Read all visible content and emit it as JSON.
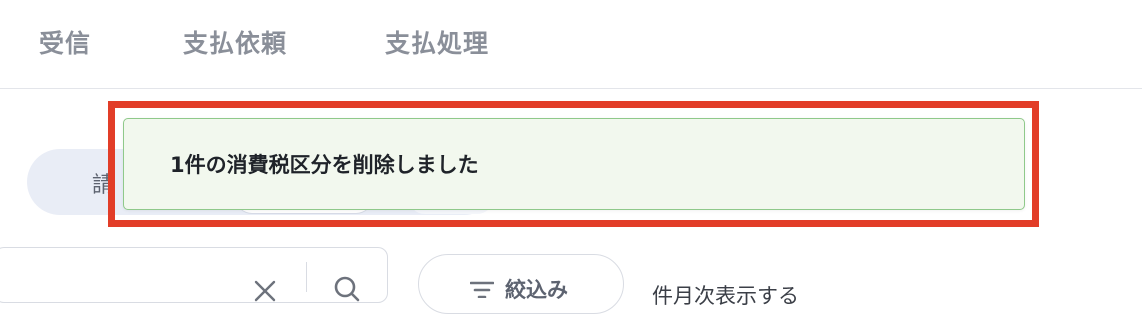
{
  "nav": {
    "tabs": [
      {
        "label": "受信"
      },
      {
        "label": "支払依頼"
      },
      {
        "label": "支払処理"
      }
    ]
  },
  "segment": {
    "visible_label": "請"
  },
  "filter": {
    "label": "絞込み"
  },
  "tail_text": "件月次表示する",
  "toast": {
    "message": "1件の消費税区分を削除しました"
  },
  "icons": {
    "clear": "close-icon",
    "search": "search-icon",
    "filter": "filter-icon"
  },
  "colors": {
    "highlight": "#e23d28",
    "toast_background": "#f2f8ee",
    "toast_border": "#8fc98a",
    "nav_text": "#8a8f99"
  }
}
